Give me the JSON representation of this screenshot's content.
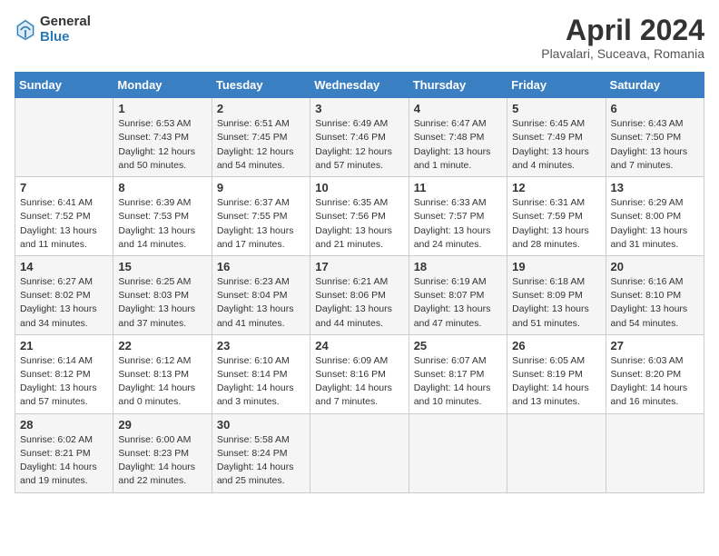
{
  "header": {
    "logo_general": "General",
    "logo_blue": "Blue",
    "title": "April 2024",
    "subtitle": "Plavalari, Suceava, Romania"
  },
  "days_of_week": [
    "Sunday",
    "Monday",
    "Tuesday",
    "Wednesday",
    "Thursday",
    "Friday",
    "Saturday"
  ],
  "weeks": [
    [
      {
        "day": "",
        "info": ""
      },
      {
        "day": "1",
        "info": "Sunrise: 6:53 AM\nSunset: 7:43 PM\nDaylight: 12 hours\nand 50 minutes."
      },
      {
        "day": "2",
        "info": "Sunrise: 6:51 AM\nSunset: 7:45 PM\nDaylight: 12 hours\nand 54 minutes."
      },
      {
        "day": "3",
        "info": "Sunrise: 6:49 AM\nSunset: 7:46 PM\nDaylight: 12 hours\nand 57 minutes."
      },
      {
        "day": "4",
        "info": "Sunrise: 6:47 AM\nSunset: 7:48 PM\nDaylight: 13 hours\nand 1 minute."
      },
      {
        "day": "5",
        "info": "Sunrise: 6:45 AM\nSunset: 7:49 PM\nDaylight: 13 hours\nand 4 minutes."
      },
      {
        "day": "6",
        "info": "Sunrise: 6:43 AM\nSunset: 7:50 PM\nDaylight: 13 hours\nand 7 minutes."
      }
    ],
    [
      {
        "day": "7",
        "info": "Sunrise: 6:41 AM\nSunset: 7:52 PM\nDaylight: 13 hours\nand 11 minutes."
      },
      {
        "day": "8",
        "info": "Sunrise: 6:39 AM\nSunset: 7:53 PM\nDaylight: 13 hours\nand 14 minutes."
      },
      {
        "day": "9",
        "info": "Sunrise: 6:37 AM\nSunset: 7:55 PM\nDaylight: 13 hours\nand 17 minutes."
      },
      {
        "day": "10",
        "info": "Sunrise: 6:35 AM\nSunset: 7:56 PM\nDaylight: 13 hours\nand 21 minutes."
      },
      {
        "day": "11",
        "info": "Sunrise: 6:33 AM\nSunset: 7:57 PM\nDaylight: 13 hours\nand 24 minutes."
      },
      {
        "day": "12",
        "info": "Sunrise: 6:31 AM\nSunset: 7:59 PM\nDaylight: 13 hours\nand 28 minutes."
      },
      {
        "day": "13",
        "info": "Sunrise: 6:29 AM\nSunset: 8:00 PM\nDaylight: 13 hours\nand 31 minutes."
      }
    ],
    [
      {
        "day": "14",
        "info": "Sunrise: 6:27 AM\nSunset: 8:02 PM\nDaylight: 13 hours\nand 34 minutes."
      },
      {
        "day": "15",
        "info": "Sunrise: 6:25 AM\nSunset: 8:03 PM\nDaylight: 13 hours\nand 37 minutes."
      },
      {
        "day": "16",
        "info": "Sunrise: 6:23 AM\nSunset: 8:04 PM\nDaylight: 13 hours\nand 41 minutes."
      },
      {
        "day": "17",
        "info": "Sunrise: 6:21 AM\nSunset: 8:06 PM\nDaylight: 13 hours\nand 44 minutes."
      },
      {
        "day": "18",
        "info": "Sunrise: 6:19 AM\nSunset: 8:07 PM\nDaylight: 13 hours\nand 47 minutes."
      },
      {
        "day": "19",
        "info": "Sunrise: 6:18 AM\nSunset: 8:09 PM\nDaylight: 13 hours\nand 51 minutes."
      },
      {
        "day": "20",
        "info": "Sunrise: 6:16 AM\nSunset: 8:10 PM\nDaylight: 13 hours\nand 54 minutes."
      }
    ],
    [
      {
        "day": "21",
        "info": "Sunrise: 6:14 AM\nSunset: 8:12 PM\nDaylight: 13 hours\nand 57 minutes."
      },
      {
        "day": "22",
        "info": "Sunrise: 6:12 AM\nSunset: 8:13 PM\nDaylight: 14 hours\nand 0 minutes."
      },
      {
        "day": "23",
        "info": "Sunrise: 6:10 AM\nSunset: 8:14 PM\nDaylight: 14 hours\nand 3 minutes."
      },
      {
        "day": "24",
        "info": "Sunrise: 6:09 AM\nSunset: 8:16 PM\nDaylight: 14 hours\nand 7 minutes."
      },
      {
        "day": "25",
        "info": "Sunrise: 6:07 AM\nSunset: 8:17 PM\nDaylight: 14 hours\nand 10 minutes."
      },
      {
        "day": "26",
        "info": "Sunrise: 6:05 AM\nSunset: 8:19 PM\nDaylight: 14 hours\nand 13 minutes."
      },
      {
        "day": "27",
        "info": "Sunrise: 6:03 AM\nSunset: 8:20 PM\nDaylight: 14 hours\nand 16 minutes."
      }
    ],
    [
      {
        "day": "28",
        "info": "Sunrise: 6:02 AM\nSunset: 8:21 PM\nDaylight: 14 hours\nand 19 minutes."
      },
      {
        "day": "29",
        "info": "Sunrise: 6:00 AM\nSunset: 8:23 PM\nDaylight: 14 hours\nand 22 minutes."
      },
      {
        "day": "30",
        "info": "Sunrise: 5:58 AM\nSunset: 8:24 PM\nDaylight: 14 hours\nand 25 minutes."
      },
      {
        "day": "",
        "info": ""
      },
      {
        "day": "",
        "info": ""
      },
      {
        "day": "",
        "info": ""
      },
      {
        "day": "",
        "info": ""
      }
    ]
  ]
}
